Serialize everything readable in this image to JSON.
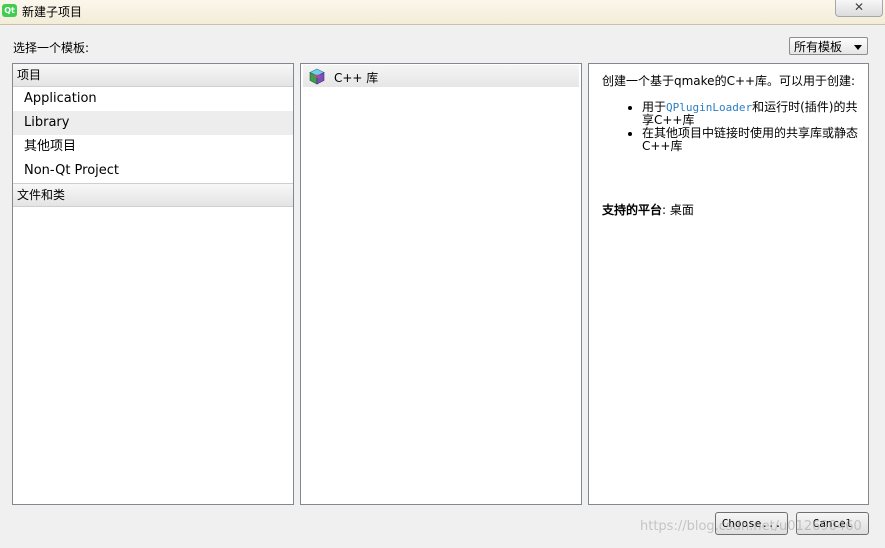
{
  "window": {
    "title": "新建子项目",
    "app_icon_text": "Qt",
    "close_glyph": "✕"
  },
  "header": {
    "choose_template_label": "选择一个模板:",
    "filter": {
      "selected": "所有模板"
    }
  },
  "categories": {
    "groups": [
      {
        "label": "项目",
        "items": [
          {
            "label": "Application"
          },
          {
            "label": "Library",
            "selected": true
          },
          {
            "label": "其他项目"
          },
          {
            "label": "Non-Qt Project"
          }
        ]
      },
      {
        "label": "文件和类",
        "items": []
      }
    ]
  },
  "templates": {
    "items": [
      {
        "label": "C++ 库",
        "icon": "cube-icon",
        "selected": true
      }
    ]
  },
  "description": {
    "intro": "创建一个基于qmake的C++库。可以用于创建:",
    "bullets": [
      {
        "pre": "用于",
        "highlight": "QPluginLoader",
        "post": "和运行时(插件)的共享C++库"
      },
      {
        "text": "在其他项目中链接时使用的共享库或静态C++库"
      }
    ],
    "platform_label": "支持的平台",
    "platform_sep": ": ",
    "platform_value": "桌面"
  },
  "buttons": {
    "choose": "Choose...",
    "cancel": "Cancel"
  },
  "watermark": "https://blog.csdn.net/u012690460"
}
